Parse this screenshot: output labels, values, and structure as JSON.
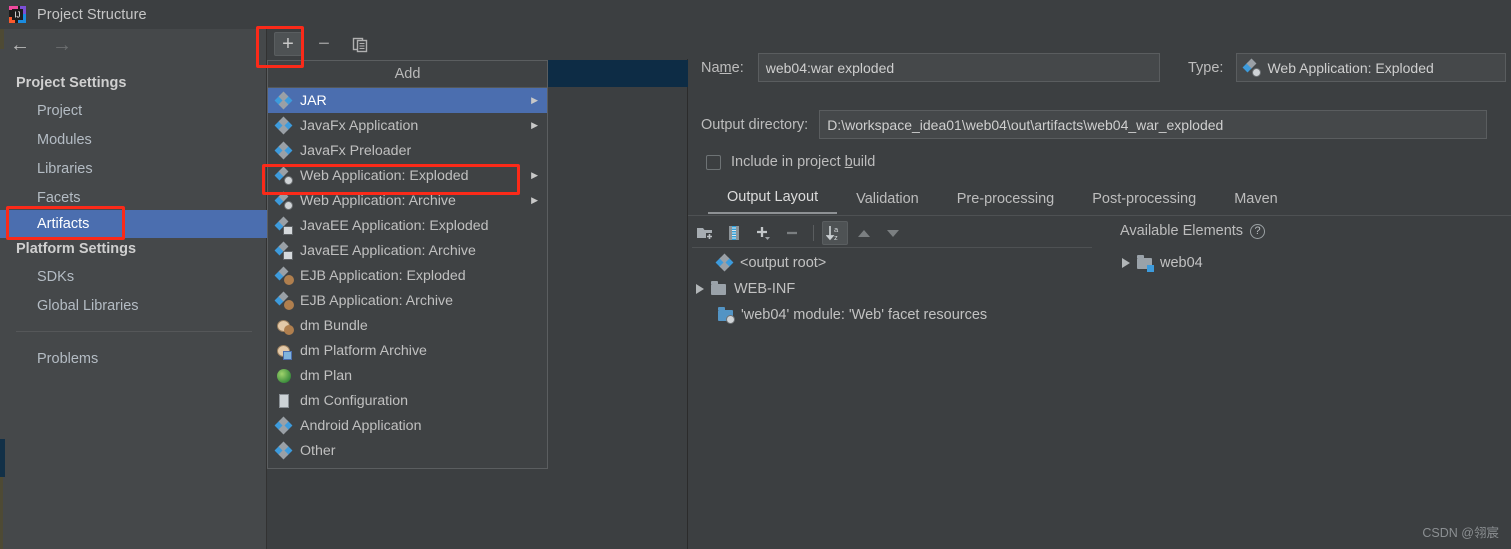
{
  "window": {
    "title": "Project Structure",
    "app_icon": "intellij-idea-logo"
  },
  "sidebar": {
    "back_icon": "←",
    "forward_icon": "→",
    "sections": [
      {
        "heading": "Project Settings",
        "items": [
          {
            "label": "Project",
            "selected": false
          },
          {
            "label": "Modules",
            "selected": false
          },
          {
            "label": "Libraries",
            "selected": false
          },
          {
            "label": "Facets",
            "selected": false
          },
          {
            "label": "Artifacts",
            "selected": true
          }
        ]
      },
      {
        "heading": "Platform Settings",
        "items": [
          {
            "label": "SDKs",
            "selected": false
          },
          {
            "label": "Global Libraries",
            "selected": false
          }
        ]
      }
    ],
    "footer_item": {
      "label": "Problems"
    }
  },
  "center_toolbar": {
    "add_label": "+",
    "remove_label": "−",
    "copy_icon": "copy-icon"
  },
  "add_menu": {
    "title": "Add",
    "items": [
      {
        "label": "JAR",
        "icon": "artifact-icon",
        "submenu": true,
        "highlight": true
      },
      {
        "label": "JavaFx Application",
        "icon": "artifact-icon",
        "submenu": true,
        "highlight": false
      },
      {
        "label": "JavaFx Preloader",
        "icon": "artifact-icon",
        "submenu": false,
        "highlight": false
      },
      {
        "label": "Web Application: Exploded",
        "icon": "web-artifact-icon",
        "submenu": true,
        "highlight": false
      },
      {
        "label": "Web Application: Archive",
        "icon": "web-artifact-icon",
        "submenu": true,
        "highlight": false
      },
      {
        "label": "JavaEE Application: Exploded",
        "icon": "javaee-artifact-icon",
        "submenu": false,
        "highlight": false
      },
      {
        "label": "JavaEE Application: Archive",
        "icon": "javaee-artifact-icon",
        "submenu": false,
        "highlight": false
      },
      {
        "label": "EJB Application: Exploded",
        "icon": "ejb-artifact-icon",
        "submenu": false,
        "highlight": false
      },
      {
        "label": "EJB Application: Archive",
        "icon": "ejb-artifact-icon",
        "submenu": false,
        "highlight": false
      },
      {
        "label": "dm Bundle",
        "icon": "dm-bundle-icon",
        "submenu": false,
        "highlight": false
      },
      {
        "label": "dm Platform Archive",
        "icon": "dm-platform-icon",
        "submenu": false,
        "highlight": false
      },
      {
        "label": "dm Plan",
        "icon": "dm-plan-icon",
        "submenu": false,
        "highlight": false
      },
      {
        "label": "dm Configuration",
        "icon": "dm-config-icon",
        "submenu": false,
        "highlight": false
      },
      {
        "label": "Android Application",
        "icon": "artifact-icon",
        "submenu": false,
        "highlight": false
      },
      {
        "label": "Other",
        "icon": "artifact-icon",
        "submenu": false,
        "highlight": false
      }
    ],
    "submenu_arrow": "▶"
  },
  "details": {
    "name_label": "Name:",
    "name_value": "web04:war exploded",
    "type_label": "Type:",
    "type_value": "Web Application: Exploded",
    "type_icon": "web-artifact-icon",
    "output_label": "Output directory:",
    "output_value": "D:\\workspace_idea01\\web04\\out\\artifacts\\web04_war_exploded",
    "include_checkbox_label": "Include in project build",
    "include_checked": false,
    "tabs": [
      {
        "label": "Output Layout",
        "active": true
      },
      {
        "label": "Validation",
        "active": false
      },
      {
        "label": "Pre-processing",
        "active": false
      },
      {
        "label": "Post-processing",
        "active": false
      },
      {
        "label": "Maven",
        "active": false
      }
    ],
    "layout_toolbar": [
      {
        "name": "create-directory-icon",
        "pressed": false
      },
      {
        "name": "create-archive-icon",
        "pressed": false
      },
      {
        "name": "add-copy-icon",
        "pressed": false
      },
      {
        "name": "remove-icon",
        "pressed": false
      },
      {
        "name": "sort-az-icon",
        "pressed": true
      },
      {
        "name": "move-up-icon",
        "pressed": false
      },
      {
        "name": "move-down-icon",
        "pressed": false
      }
    ],
    "available_elements_label": "Available Elements",
    "available_help_glyph": "?",
    "output_tree": [
      {
        "label": "<output root>",
        "icon": "artifact-icon",
        "indent": 0,
        "expander": false
      },
      {
        "label": "WEB-INF",
        "icon": "folder-icon",
        "indent": 0,
        "expander": true
      },
      {
        "label": "'web04' module: 'Web' facet resources",
        "icon": "web-facet-icon",
        "indent": 1,
        "expander": false
      }
    ],
    "available_tree": [
      {
        "label": "web04",
        "icon": "module-folder-icon",
        "expander": true
      }
    ]
  },
  "watermark": "CSDN @翎宸",
  "colors": {
    "selection_blue": "#4b6eaf",
    "row_selected_dark": "#0d2c45",
    "highlight_red": "#fb2a19",
    "panel_bg": "#3c3f41",
    "sidebar_bg": "#45484a"
  }
}
